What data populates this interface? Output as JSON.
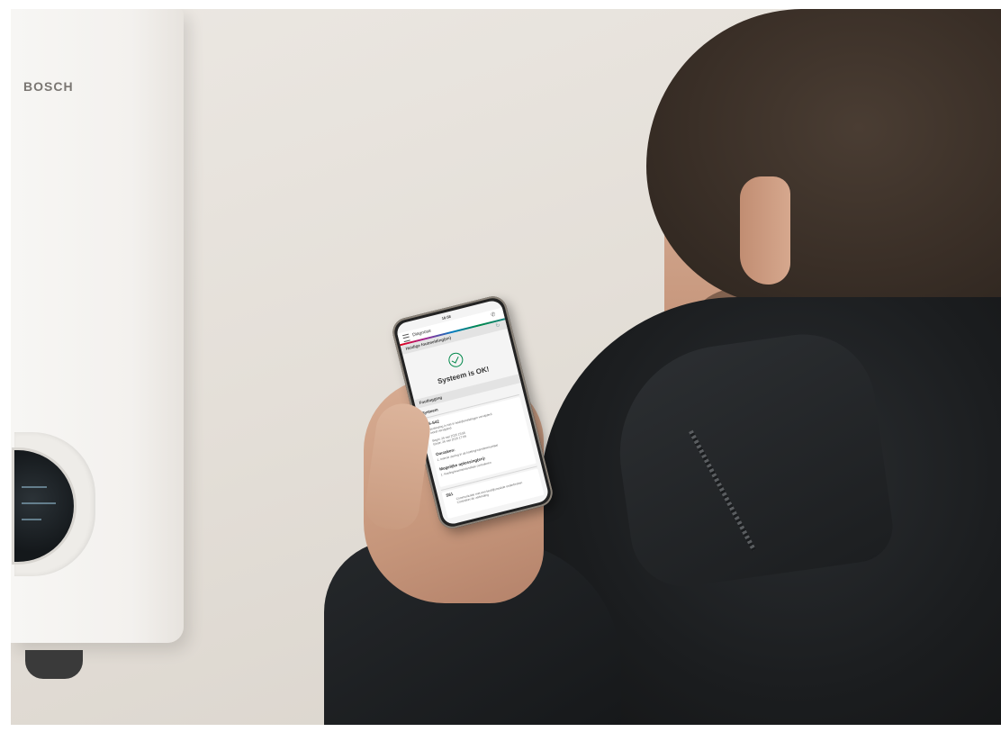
{
  "boiler": {
    "brand": "BOSCH"
  },
  "phone": {
    "status_time": "16:58",
    "header_title": "Diagnose",
    "current_fault_section": "Huidige foutmelding(en)",
    "status_message": "Systeem is OK!",
    "history_section": "Foutlogging",
    "system_label": "Systeem",
    "fault_code": "S-S42",
    "fault_desc_line1": "Verbinding is niet in bedrijfsmeldingen verwijderd",
    "fault_desc_line2": "wordt verwijderd",
    "begin_line": "Begin: 26 mei 2025 15:56",
    "end_line": "Einde: 26 mei 2025 17:09",
    "causes_title": "Oorzaken:",
    "causes_item": "1. Interne storing in de koeling/warmtewisselaar",
    "solutions_title": "Mogelijke oplossing(en):",
    "solutions_item": "1. Koeling/warmtewisselaar controleren",
    "next_code": "S61",
    "next_desc_line1": "Communicatie met een bedrijfsmodule onderbroken",
    "next_desc_line2": "Controleer de verbinding"
  },
  "colors": {
    "brand_strip": [
      "#e2001a",
      "#9e2896",
      "#007bc0",
      "#00884a",
      "#18837e"
    ],
    "ok_green": "#00884a"
  },
  "icons": [
    "menu-icon",
    "phone-icon",
    "refresh-icon",
    "check-circle-icon",
    "chevron-icon"
  ]
}
